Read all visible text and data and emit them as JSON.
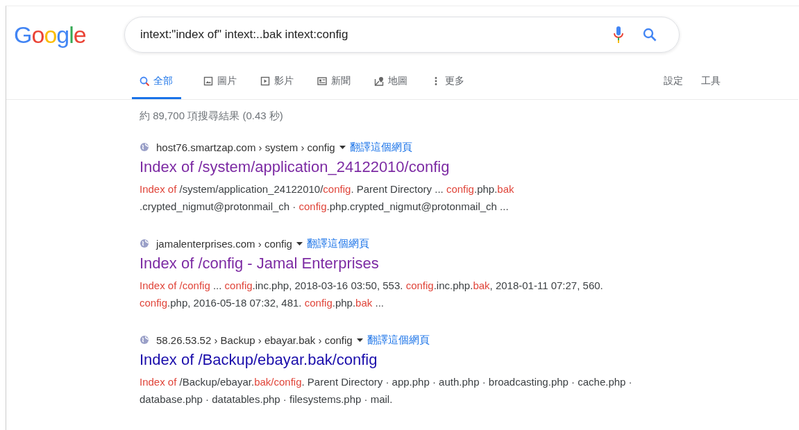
{
  "logo": "Google",
  "search": {
    "value": "intext:\"index of\" intext:..bak intext:config"
  },
  "tabs": [
    {
      "label": "全部",
      "kind": "all",
      "selected": true
    },
    {
      "label": "圖片",
      "kind": "images",
      "selected": false
    },
    {
      "label": "影片",
      "kind": "videos",
      "selected": false
    },
    {
      "label": "新聞",
      "kind": "news",
      "selected": false
    },
    {
      "label": "地圖",
      "kind": "maps",
      "selected": false
    },
    {
      "label": "更多",
      "kind": "more",
      "selected": false
    }
  ],
  "tools": [
    "設定",
    "工具"
  ],
  "stats": "約 89,700 項搜尋結果 (0.43 秒)",
  "results": [
    {
      "breadcrumb": "host76.smartzap.com › system › config",
      "translate": "翻譯這個網頁",
      "title": "Index of /system/application_24122010/config",
      "visited": true,
      "snippet": [
        {
          "text": "Index of",
          "highlight": true
        },
        {
          "text": " /system/application_24122010/",
          "highlight": false
        },
        {
          "text": "config",
          "highlight": true
        },
        {
          "text": ". Parent Directory ... ",
          "highlight": false
        },
        {
          "text": "config",
          "highlight": true
        },
        {
          "text": ".php.",
          "highlight": false
        },
        {
          "text": "bak",
          "highlight": true
        },
        {
          "text": " .crypted_nigmut@protonmail_ch · ",
          "highlight": false
        },
        {
          "text": "config",
          "highlight": true
        },
        {
          "text": ".php.crypted_nigmut@protonmail_ch ...",
          "highlight": false
        }
      ]
    },
    {
      "breadcrumb": "jamalenterprises.com › config",
      "translate": "翻譯這個網頁",
      "title": "Index of /config - Jamal Enterprises",
      "visited": true,
      "snippet": [
        {
          "text": "Index of /config",
          "highlight": true
        },
        {
          "text": " ... ",
          "highlight": false
        },
        {
          "text": "config",
          "highlight": true
        },
        {
          "text": ".inc.php, 2018-03-16 03:50, 553. ",
          "highlight": false
        },
        {
          "text": "config",
          "highlight": true
        },
        {
          "text": ".inc.php.",
          "highlight": false
        },
        {
          "text": "bak",
          "highlight": true
        },
        {
          "text": ", 2018-01-11 07:27, 560. ",
          "highlight": false
        },
        {
          "text": "config",
          "highlight": true
        },
        {
          "text": ".php, 2016-05-18 07:32, 481. ",
          "highlight": false
        },
        {
          "text": "config",
          "highlight": true
        },
        {
          "text": ".php.",
          "highlight": false
        },
        {
          "text": "bak",
          "highlight": true
        },
        {
          "text": " ...",
          "highlight": false
        }
      ]
    },
    {
      "breadcrumb": "58.26.53.52 › Backup › ebayar.bak › config",
      "translate": "翻譯這個網頁",
      "title": "Index of /Backup/ebayar.bak/config",
      "visited": false,
      "snippet": [
        {
          "text": "Index of",
          "highlight": true
        },
        {
          "text": " /Backup/ebayar.",
          "highlight": false
        },
        {
          "text": "bak/config",
          "highlight": true
        },
        {
          "text": ". Parent Directory · app.php · auth.php · broadcasting.php · cache.php · database.php · datatables.php · filesystems.php · mail.",
          "highlight": false
        }
      ]
    }
  ]
}
